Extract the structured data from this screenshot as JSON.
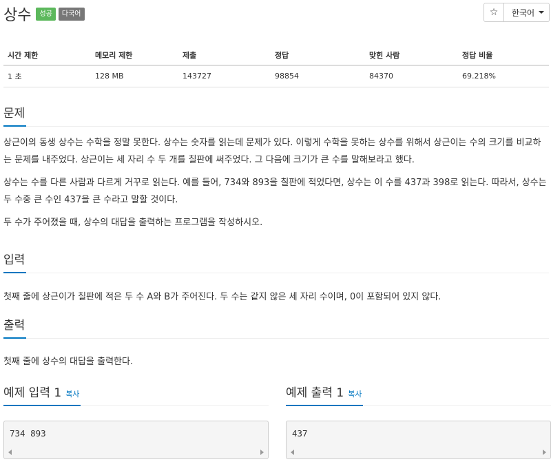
{
  "problem": {
    "title": "상수",
    "badges": {
      "status": "성공",
      "multilang": "다국어"
    }
  },
  "toolbar": {
    "star_icon": "☆",
    "language": "한국어"
  },
  "info_table": {
    "headers": [
      "시간 제한",
      "메모리 제한",
      "제출",
      "정답",
      "맞힌 사람",
      "정답 비율"
    ],
    "values": [
      "1 초",
      "128 MB",
      "143727",
      "98854",
      "84370",
      "69.218%"
    ]
  },
  "sections": {
    "description": {
      "title": "문제",
      "paragraphs": [
        "상근이의 동생 상수는 수학을 정말 못한다. 상수는 숫자를 읽는데 문제가 있다. 이렇게 수학을 못하는 상수를 위해서 상근이는 수의 크기를 비교하는 문제를 내주었다. 상근이는 세 자리 수 두 개를 칠판에 써주었다. 그 다음에 크기가 큰 수를 말해보라고 했다.",
        "상수는 수를 다른 사람과 다르게 거꾸로 읽는다. 예를 들어, 734와 893을 칠판에 적었다면, 상수는 이 수를 437과 398로 읽는다. 따라서, 상수는 두 수중 큰 수인 437을 큰 수라고 말할 것이다.",
        "두 수가 주어졌을 때, 상수의 대답을 출력하는 프로그램을 작성하시오."
      ]
    },
    "input": {
      "title": "입력",
      "text": "첫째 줄에 상근이가 칠판에 적은 두 수 A와 B가 주어진다. 두 수는 같지 않은 세 자리 수이며, 0이 포함되어 있지 않다."
    },
    "output": {
      "title": "출력",
      "text": "첫째 줄에 상수의 대답을 출력한다."
    }
  },
  "samples": {
    "input": {
      "title": "예제 입력 1",
      "copy_label": "복사",
      "content": "734 893"
    },
    "output": {
      "title": "예제 출력 1",
      "copy_label": "복사",
      "content": "437"
    }
  },
  "colors": {
    "accent": "#0076c0",
    "success": "#5cb85c",
    "default_label": "#777777"
  }
}
